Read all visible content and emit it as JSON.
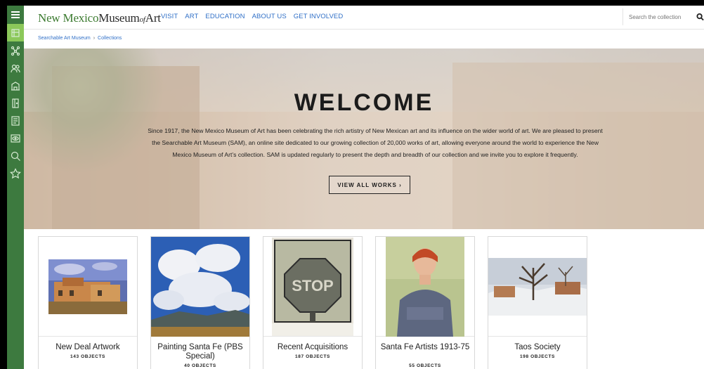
{
  "header": {
    "logo": {
      "part1": "New Mexico",
      "part2": "Museum",
      "part3": "of",
      "part4": "Art"
    },
    "nav": [
      "VISIT",
      "ART",
      "EDUCATION",
      "ABOUT US",
      "GET INVOLVED"
    ],
    "search_placeholder": "Search the collection"
  },
  "sidebar": {
    "icons": [
      "menu-icon",
      "collections-icon",
      "network-icon",
      "people-icon",
      "building-icon",
      "door-icon",
      "document-icon",
      "eye-icon",
      "search-icon",
      "star-icon"
    ]
  },
  "breadcrumb": {
    "root": "Searchable Art Museum",
    "separator": "›",
    "current": "Collections"
  },
  "hero": {
    "title": "WELCOME",
    "body": "Since 1917, the New Mexico Museum of Art has been celebrating the rich artistry of New Mexican art and its influence on the wider world of art. We are pleased to present the Searchable Art Museum (SAM), an online site dedicated to our growing collection of 20,000 works of art, allowing everyone around the world to experience the New Mexico Museum of Art’s collection. SAM is updated regularly to present the depth and breadth of our collection and we invite you to explore it frequently.",
    "button": "VIEW ALL WORKS ›"
  },
  "collections": [
    {
      "title": "New Deal Artwork",
      "count": "143 OBJECTS"
    },
    {
      "title": "Painting Santa Fe (PBS Special)",
      "count": "40 OBJECTS"
    },
    {
      "title": "Recent Acquisitions",
      "count": "187 OBJECTS"
    },
    {
      "title": "Santa Fe Artists 1913-75",
      "count": "55 OBJECTS"
    },
    {
      "title": "Taos Society",
      "count": "198 OBJECTS"
    }
  ],
  "colors": {
    "sidebar": "#3d7a3f",
    "sidebar_active": "#8cc85a",
    "link": "#2f6fc7",
    "logo_green": "#3b7a2f"
  }
}
